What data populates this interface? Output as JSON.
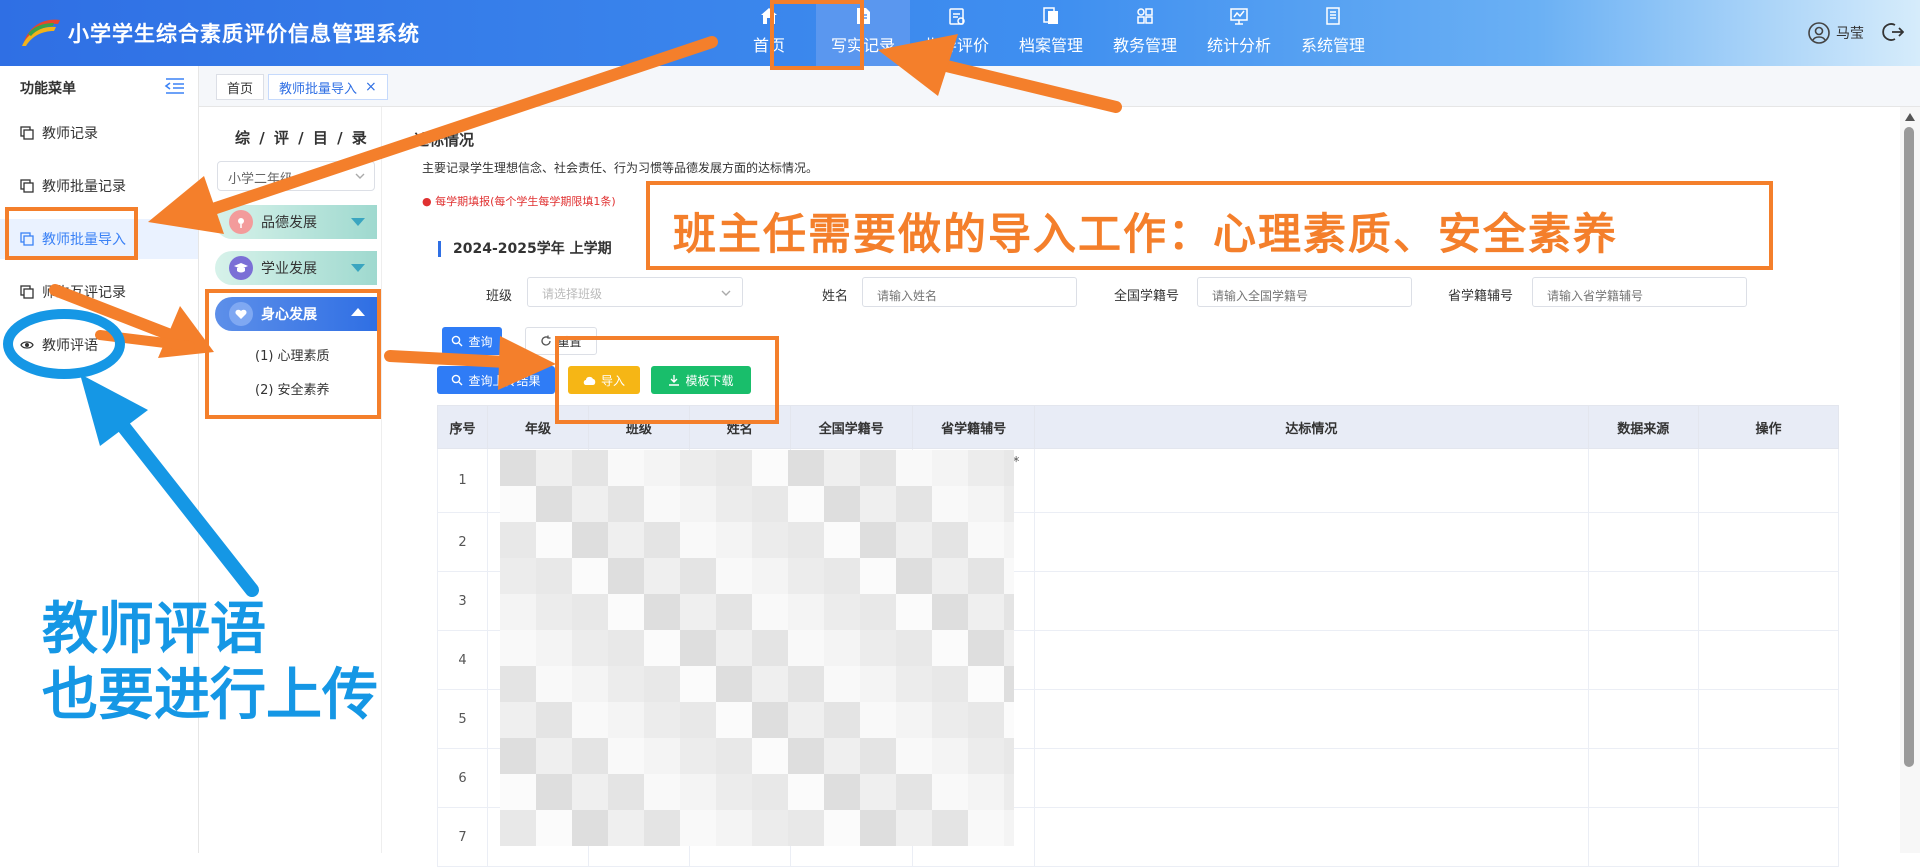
{
  "header": {
    "title": "小学学生综合素质评价信息管理系统",
    "nav": [
      {
        "label": "首页",
        "icon": "home-icon",
        "active": false
      },
      {
        "label": "写实记录",
        "icon": "document-edit-icon",
        "active": true
      },
      {
        "label": "指导评价",
        "icon": "evaluate-icon",
        "active": false
      },
      {
        "label": "档案管理",
        "icon": "archive-icon",
        "active": false
      },
      {
        "label": "教务管理",
        "icon": "grid-icon",
        "active": false
      },
      {
        "label": "统计分析",
        "icon": "chart-icon",
        "active": false
      },
      {
        "label": "系统管理",
        "icon": "settings-doc-icon",
        "active": false
      }
    ],
    "user_name": "马莹"
  },
  "sidebar": {
    "title": "功能菜单",
    "items": [
      {
        "label": "教师记录"
      },
      {
        "label": "教师批量记录"
      },
      {
        "label": "教师批量导入"
      },
      {
        "label": "师生互评记录"
      },
      {
        "label": "教师评语"
      }
    ]
  },
  "tabs": [
    {
      "label": "首页"
    },
    {
      "label": "教师批量导入",
      "close": "×"
    }
  ],
  "catalog": {
    "title": "综 / 评 / 目 / 录",
    "grade_select": "小学二年级",
    "groups": [
      {
        "label": "品德发展"
      },
      {
        "label": "学业发展"
      },
      {
        "label": "身心发展"
      }
    ],
    "sub_items": [
      "(1) 心理素质",
      "(2) 安全素养"
    ]
  },
  "main": {
    "title": "达标情况",
    "description": "主要记录学生理想信念、社会责任、行为习惯等品德发展方面的达标情况。",
    "notice": "每学期填报(每个学生每学期限填1条)",
    "term": "2024-2025学年 上学期",
    "filters": [
      {
        "label": "班级",
        "placeholder": "请选择班级"
      },
      {
        "label": "姓名",
        "placeholder": "请输入姓名"
      },
      {
        "label": "全国学籍号",
        "placeholder": "请输入全国学籍号"
      },
      {
        "label": "省学籍辅号",
        "placeholder": "请输入省学籍辅号"
      }
    ],
    "buttons": {
      "search": "查询",
      "reset": "重置",
      "query_upload": "查询上传结果",
      "import": "导入",
      "template_download": "模板下载"
    },
    "table": {
      "headers": [
        "序号",
        "年级",
        "班级",
        "姓名",
        "全国学籍号",
        "省学籍辅号",
        "达标情况",
        "数据来源",
        "操作"
      ],
      "rows": [
        {
          "no": "1",
          "national_id": "G370*********",
          "province_id": "2022*********"
        },
        {
          "no": "2",
          "national_id": "",
          "province_id": ""
        },
        {
          "no": "3",
          "national_id": "",
          "province_id": ""
        },
        {
          "no": "4",
          "national_id": "",
          "province_id": ""
        },
        {
          "no": "5",
          "national_id": "",
          "province_id": ""
        },
        {
          "no": "6",
          "national_id": "",
          "province_id": ""
        },
        {
          "no": "7",
          "national_id": "",
          "province_id": ""
        }
      ]
    }
  },
  "annotations": {
    "orange_text": "班主任需要做的导入工作：心理素质、安全素养",
    "blue_line1": "教师评语",
    "blue_line2": "也要进行上传",
    "colors": {
      "orange": "#f47f2b",
      "blue": "#1597e5"
    }
  }
}
